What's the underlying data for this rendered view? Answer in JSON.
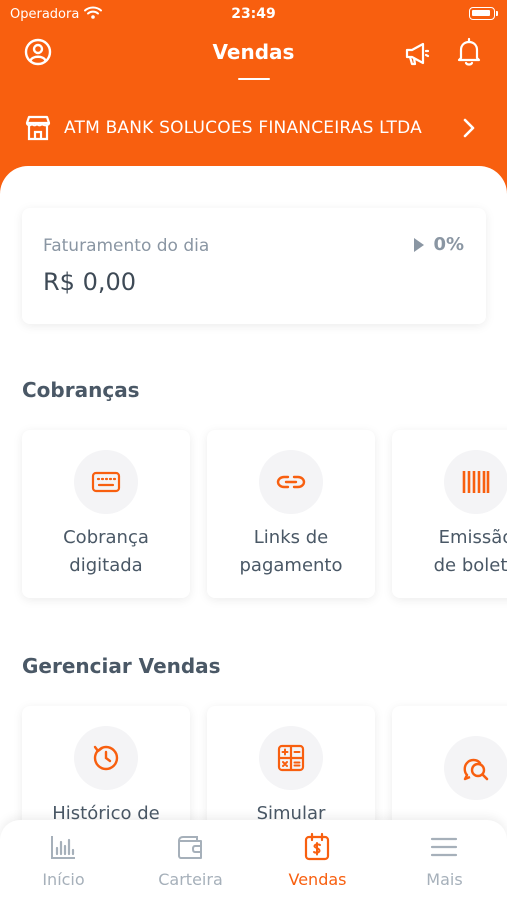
{
  "status_bar": {
    "carrier": "Operadora",
    "time": "23:49"
  },
  "header": {
    "title": "Vendas",
    "company": "ATM BANK SOLUCOES FINANCEIRAS LTDA"
  },
  "billing": {
    "label": "Faturamento do dia",
    "value": "R$ 0,00",
    "percent": "0%"
  },
  "sections": {
    "cobrancas": {
      "title": "Cobranças",
      "items": [
        {
          "line1": "Cobrança",
          "line2": "digitada",
          "icon": "keyboard-icon"
        },
        {
          "line1": "Links de",
          "line2": "pagamento",
          "icon": "link-icon"
        },
        {
          "line1": "Emissão",
          "line2": "de boleto",
          "icon": "barcode-icon"
        }
      ]
    },
    "gerenciar": {
      "title": "Gerenciar Vendas",
      "items": [
        {
          "line1": "Histórico de",
          "line2": "",
          "icon": "history-icon"
        },
        {
          "line1": "Simular",
          "line2": "",
          "icon": "calculator-icon"
        },
        {
          "line1": "",
          "line2": "",
          "icon": "chat-search-icon"
        }
      ]
    }
  },
  "tabs": [
    {
      "label": "Início",
      "icon": "bar-chart-icon"
    },
    {
      "label": "Carteira",
      "icon": "wallet-icon"
    },
    {
      "label": "Vendas",
      "icon": "calendar-dollar-icon"
    },
    {
      "label": "Mais",
      "icon": "menu-icon"
    }
  ],
  "colors": {
    "brand": "#f85f0f",
    "text": "#4a5866",
    "muted": "#a6b0ba",
    "background": "#ffffff"
  }
}
